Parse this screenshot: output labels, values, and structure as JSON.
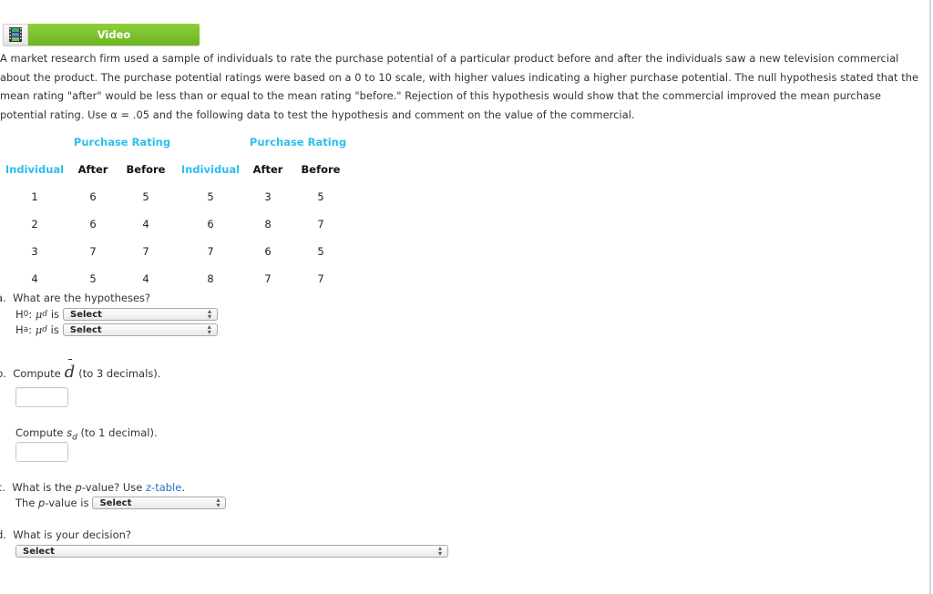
{
  "video": {
    "label": "Video",
    "icon": "film-strip-icon"
  },
  "prompt": "A market research firm used a sample of individuals to rate the purchase potential of a particular product before and after the individuals saw a new television commercial about the product. The purchase potential ratings were based on a 0 to 10 scale, with higher values indicating a higher purchase potential. The null hypothesis stated that the mean rating \"after\" would be less than or equal to the mean rating \"before.\" Rejection of this hypothesis would show that the commercial improved the mean purchase potential rating. Use α = .05 and the following data to test the hypothesis and comment on the value of the commercial.",
  "table": {
    "group_header": "Purchase Rating",
    "headers": [
      "Individual",
      "After",
      "Before",
      "Individual",
      "After",
      "Before"
    ],
    "rows": [
      [
        "1",
        "6",
        "5",
        "5",
        "3",
        "5"
      ],
      [
        "2",
        "6",
        "4",
        "6",
        "8",
        "7"
      ],
      [
        "3",
        "7",
        "7",
        "7",
        "6",
        "5"
      ],
      [
        "4",
        "5",
        "4",
        "8",
        "7",
        "7"
      ]
    ]
  },
  "questions": {
    "a": {
      "marker": "a.",
      "text": "What are the hypotheses?",
      "h0_label": "H",
      "h0_sub": "0",
      "ha_label": "H",
      "ha_sub": "a",
      "mu": "μ",
      "mu_sub": "d",
      "is": "is",
      "h0_select": "Select",
      "ha_select": "Select"
    },
    "b": {
      "marker": "b.",
      "compute": "Compute",
      "d": "d",
      "suffix": "(to 3 decimals).",
      "sd_compute": "Compute",
      "sd_s": "s",
      "sd_sub": "d",
      "sd_suffix": "(to 1 decimal)."
    },
    "c": {
      "marker": "c.",
      "text_pre": "What is the",
      "p": "p",
      "text_mid": "-value? Use",
      "link": "z-table",
      "link_after": ".",
      "line2_pre": "The",
      "line2_p": "p",
      "line2_post": "-value is",
      "select": "Select"
    },
    "d": {
      "marker": "d.",
      "text": "What is your decision?",
      "select": "Select"
    }
  },
  "colors": {
    "accent_cyan": "#2cc0ee",
    "video_green": "#7cc22c",
    "link_blue": "#2a6fc9"
  }
}
